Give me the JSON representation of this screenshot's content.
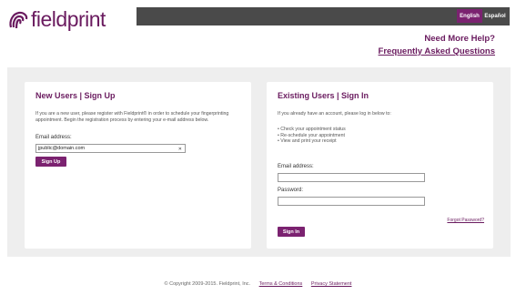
{
  "brand": {
    "logo_text": "fieldprint",
    "color": "#6a1b5f"
  },
  "header": {
    "lang_english": "English",
    "lang_espanol": "Español"
  },
  "help": {
    "title": "Need More Help?",
    "faq_link": "Frequently Asked Questions"
  },
  "new_users": {
    "title": "New Users | Sign Up",
    "intro": "If you are a new user, please register with Fieldprint® in order to schedule your fingerprinting appointment. Begin the registration process by entering your e-mail address below.",
    "email_label": "Email address:",
    "email_value": "jpublic@domain.com",
    "signup_button": "Sign Up"
  },
  "existing_users": {
    "title": "Existing Users | Sign In",
    "intro": "If you already have an account, please log in below to:",
    "bullets": [
      "Check your appointment status",
      "Re-schedule your appointment",
      "View and print your receipt"
    ],
    "email_label": "Email address:",
    "password_label": "Password:",
    "forgot_link": "Forgot Password?",
    "signin_button": "Sign In"
  },
  "footer": {
    "copyright": "© Copyright 2009-2015. Fieldprint, Inc.",
    "terms_link": "Terms & Conditions",
    "privacy_link": "Privacy Statement"
  }
}
